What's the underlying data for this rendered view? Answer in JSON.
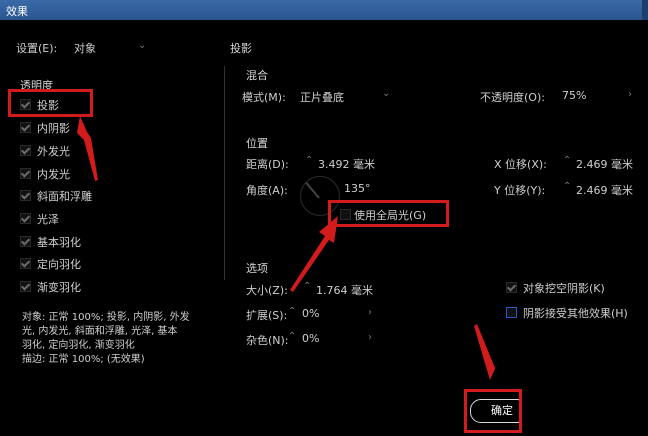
{
  "window": {
    "title": "效果"
  },
  "settings": {
    "label": "设置(E):",
    "value": "对象"
  },
  "left": {
    "section": "透明度",
    "effects": [
      {
        "label": "投影",
        "checked": true
      },
      {
        "label": "内阴影",
        "checked": true
      },
      {
        "label": "外发光",
        "checked": true
      },
      {
        "label": "内发光",
        "checked": true
      },
      {
        "label": "斜面和浮雕",
        "checked": true
      },
      {
        "label": "光泽",
        "checked": true
      },
      {
        "label": "基本羽化",
        "checked": true
      },
      {
        "label": "定向羽化",
        "checked": true
      },
      {
        "label": "渐变羽化",
        "checked": true
      }
    ],
    "summary": [
      "对象: 正常 100%; 投影, 内阴影, 外发",
      "光, 内发光, 斜面和浮雕, 光泽, 基本",
      "羽化, 定向羽化, 渐变羽化",
      "描边: 正常 100%; (无效果)"
    ]
  },
  "right": {
    "title": "投影",
    "blend": {
      "header": "混合",
      "mode_label": "模式(M):",
      "mode_value": "正片叠底",
      "opacity_label": "不透明度(O):",
      "opacity_value": "75%"
    },
    "position": {
      "header": "位置",
      "distance_label": "距离(D):",
      "distance_value": "3.492 毫米",
      "angle_label": "角度(A):",
      "angle_value": "135°",
      "global_light_label": "使用全局光(G)",
      "global_light_checked": false,
      "x_label": "X 位移(X):",
      "x_value": "2.469 毫米",
      "y_label": "Y 位移(Y):",
      "y_value": "2.469 毫米"
    },
    "options": {
      "header": "选项",
      "size_label": "大小(Z):",
      "size_value": "1.764 毫米",
      "spread_label": "扩展(S):",
      "spread_value": "0%",
      "noise_label": "杂色(N):",
      "noise_value": "0%",
      "knockout_label": "对象挖空阴影(K)",
      "knockout_checked": true,
      "honor_label": "阴影接受其他效果(H)",
      "honor_checked": false
    }
  },
  "footer": {
    "ok_label": "确定"
  },
  "colors": {
    "highlight": "#d21b1b",
    "title_bar": "#2a5590",
    "background": "#000000"
  }
}
